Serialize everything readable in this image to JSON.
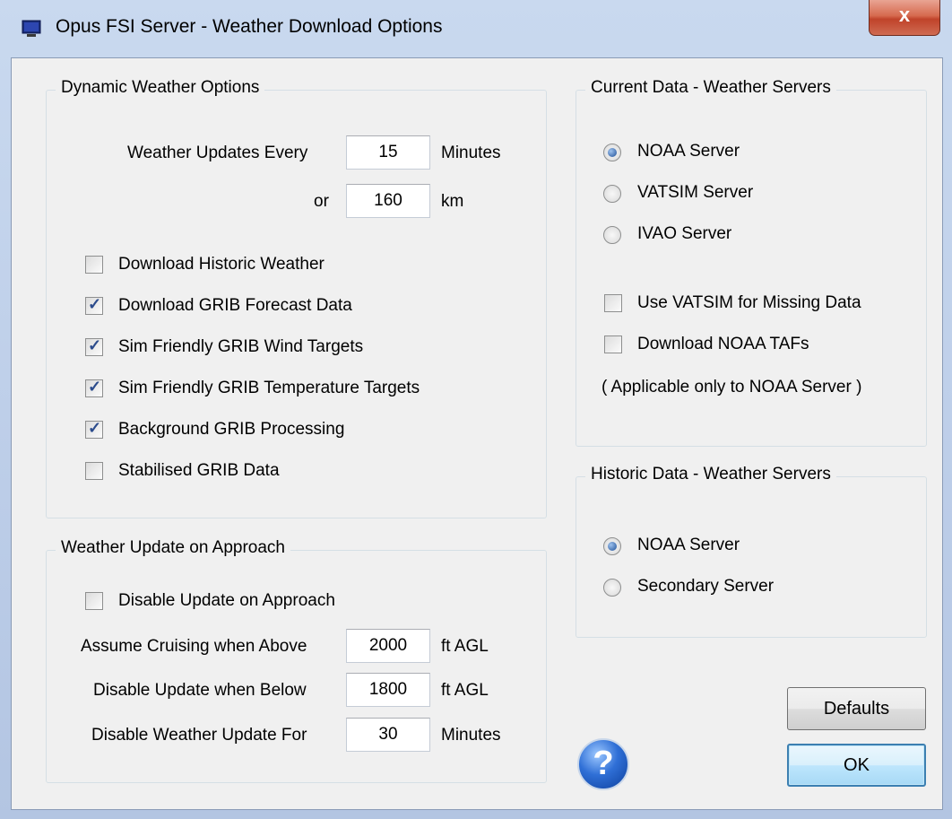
{
  "window": {
    "title": "Opus FSI Server - Weather Download Options",
    "close_label": "x"
  },
  "dynamic": {
    "title": "Dynamic Weather Options",
    "updates_label": "Weather Updates Every",
    "updates_value": "15",
    "updates_unit": "Minutes",
    "or_label": "or",
    "distance_value": "160",
    "distance_unit": "km",
    "checkboxes": [
      {
        "label": "Download Historic Weather",
        "checked": false
      },
      {
        "label": "Download GRIB Forecast Data",
        "checked": true
      },
      {
        "label": "Sim Friendly GRIB Wind Targets",
        "checked": true
      },
      {
        "label": "Sim Friendly GRIB Temperature Targets",
        "checked": true
      },
      {
        "label": "Background GRIB Processing",
        "checked": true
      },
      {
        "label": "Stabilised GRIB Data",
        "checked": false
      }
    ]
  },
  "approach": {
    "title": "Weather Update on Approach",
    "disable_label": "Disable Update on Approach",
    "disable_checked": false,
    "cruise_label": "Assume Cruising when Above",
    "cruise_value": "2000",
    "cruise_unit": "ft AGL",
    "below_label": "Disable Update when Below",
    "below_value": "1800",
    "below_unit": "ft AGL",
    "for_label": "Disable Weather Update For",
    "for_value": "30",
    "for_unit": "Minutes"
  },
  "current": {
    "title": "Current Data - Weather Servers",
    "radios": [
      {
        "label": "NOAA Server",
        "selected": true
      },
      {
        "label": "VATSIM Server",
        "selected": false
      },
      {
        "label": "IVAO Server",
        "selected": false
      }
    ],
    "checkboxes": [
      {
        "label": "Use VATSIM for Missing Data",
        "checked": false
      },
      {
        "label": "Download NOAA TAFs",
        "checked": false
      }
    ],
    "note": "( Applicable only to NOAA Server )"
  },
  "historic": {
    "title": "Historic Data - Weather Servers",
    "radios": [
      {
        "label": "NOAA Server",
        "selected": true
      },
      {
        "label": "Secondary Server",
        "selected": false
      }
    ]
  },
  "buttons": {
    "defaults": "Defaults",
    "ok": "OK",
    "help_glyph": "?"
  }
}
